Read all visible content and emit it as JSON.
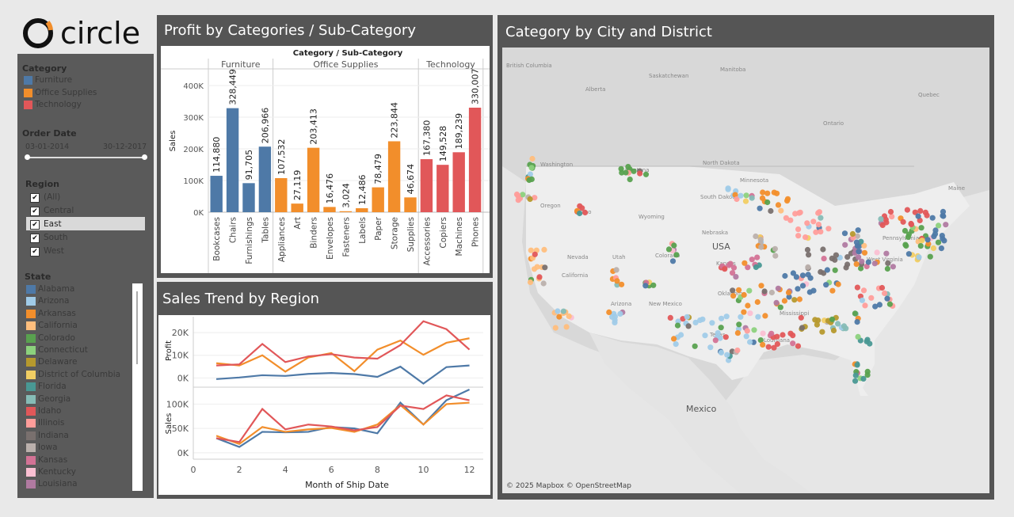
{
  "logo": {
    "text": "circle"
  },
  "sidebar": {
    "category": {
      "title": "Category",
      "items": [
        {
          "label": "Furniture",
          "color": "#4e79a7"
        },
        {
          "label": "Office Supplies",
          "color": "#f28e2b"
        },
        {
          "label": "Technology",
          "color": "#e15759"
        }
      ]
    },
    "order_date": {
      "title": "Order Date",
      "start": "03-01-2014",
      "end": "30-12-2017"
    },
    "region": {
      "title": "Region",
      "items": [
        {
          "label": "(All)",
          "checked": true
        },
        {
          "label": "Central",
          "checked": true
        },
        {
          "label": "East",
          "checked": true,
          "highlighted": true
        },
        {
          "label": "South",
          "checked": true
        },
        {
          "label": "West",
          "checked": true
        }
      ]
    },
    "state": {
      "title": "State",
      "items": [
        {
          "label": "Alabama",
          "color": "#4e79a7"
        },
        {
          "label": "Arizona",
          "color": "#a0cbe8"
        },
        {
          "label": "Arkansas",
          "color": "#f28e2b"
        },
        {
          "label": "California",
          "color": "#ffbe7d"
        },
        {
          "label": "Colorado",
          "color": "#59a14f"
        },
        {
          "label": "Connecticut",
          "color": "#8cd17d"
        },
        {
          "label": "Delaware",
          "color": "#b6992d"
        },
        {
          "label": "District of Columbia",
          "color": "#f1ce63"
        },
        {
          "label": "Florida",
          "color": "#499894"
        },
        {
          "label": "Georgia",
          "color": "#86bcb6"
        },
        {
          "label": "Idaho",
          "color": "#e15759"
        },
        {
          "label": "Illinois",
          "color": "#ff9d9a"
        },
        {
          "label": "Indiana",
          "color": "#79706e"
        },
        {
          "label": "Iowa",
          "color": "#bab0ac"
        },
        {
          "label": "Kansas",
          "color": "#d37295"
        },
        {
          "label": "Kentucky",
          "color": "#fabfd2"
        },
        {
          "label": "Louisiana",
          "color": "#b07aa1"
        }
      ]
    }
  },
  "profit_panel": {
    "title": "Profit by Categories / Sub-Category",
    "header_top": "Category  /  Sub-Category",
    "groups": [
      "Furniture",
      "Office Supplies",
      "Technology"
    ]
  },
  "trend_panel": {
    "title": "Sales Trend by Region",
    "xlabel": "Month of Ship Date"
  },
  "map_panel": {
    "title": "Category by City and District",
    "attribution": "© 2025 Mapbox © OpenStreetMap",
    "labels": [
      {
        "text": "British Columbia"
      },
      {
        "text": "Alberta"
      },
      {
        "text": "Saskatchewan"
      },
      {
        "text": "Manitoba"
      },
      {
        "text": "Ontario"
      },
      {
        "text": "Quebec"
      },
      {
        "text": "Washington"
      },
      {
        "text": "Montana"
      },
      {
        "text": "North Dakota"
      },
      {
        "text": "Minnesota"
      },
      {
        "text": "Oregon"
      },
      {
        "text": "Idaho"
      },
      {
        "text": "South Dakota"
      },
      {
        "text": "Wyoming"
      },
      {
        "text": "Nebraska"
      },
      {
        "text": "Nevada"
      },
      {
        "text": "Utah"
      },
      {
        "text": "Colorado"
      },
      {
        "text": "USA"
      },
      {
        "text": "Kansas"
      },
      {
        "text": "California"
      },
      {
        "text": "Arizona"
      },
      {
        "text": "New Mexico"
      },
      {
        "text": "Oklahoma"
      },
      {
        "text": "Texas"
      },
      {
        "text": "Mississippi"
      },
      {
        "text": "Louisiana"
      },
      {
        "text": "Mexico"
      },
      {
        "text": "Maine"
      },
      {
        "text": "Pennsylvania"
      },
      {
        "text": "West Virginia"
      }
    ]
  },
  "chart_data": [
    {
      "type": "bar",
      "title": "Profit by Categories / Sub-Category",
      "ylabel": "Sales",
      "ylim": [
        0,
        450000
      ],
      "yticks": [
        "0K",
        "100K",
        "200K",
        "300K",
        "400K"
      ],
      "categories": [
        "Bookcases",
        "Chairs",
        "Furnishings",
        "Tables",
        "Appliances",
        "Art",
        "Binders",
        "Envelopes",
        "Fasteners",
        "Labels",
        "Paper",
        "Storage",
        "Supplies",
        "Accessories",
        "Copiers",
        "Machines",
        "Phones"
      ],
      "groups": [
        "Furniture",
        "Furniture",
        "Furniture",
        "Furniture",
        "Office Supplies",
        "Office Supplies",
        "Office Supplies",
        "Office Supplies",
        "Office Supplies",
        "Office Supplies",
        "Office Supplies",
        "Office Supplies",
        "Office Supplies",
        "Technology",
        "Technology",
        "Technology",
        "Technology"
      ],
      "values": [
        114880,
        328449,
        91705,
        206966,
        107532,
        27119,
        203413,
        16476,
        3024,
        12486,
        78479,
        223844,
        46674,
        167380,
        149528,
        189239,
        330007
      ],
      "value_labels": [
        "114,880",
        "328,449",
        "91,705",
        "206,966",
        "107,532",
        "27,119",
        "203,413",
        "16,476",
        "3,024",
        "12,486",
        "78,479",
        "223,844",
        "46,674",
        "167,380",
        "149,528",
        "189,239",
        "330,007"
      ],
      "colors": {
        "Furniture": "#4e79a7",
        "Office Supplies": "#f28e2b",
        "Technology": "#e15759"
      }
    },
    {
      "type": "line",
      "title": "Sales Trend by Region",
      "xlabel": "Month of Ship Date",
      "x": [
        1,
        2,
        3,
        4,
        5,
        6,
        7,
        8,
        9,
        10,
        11,
        12
      ],
      "xticks": [
        0,
        2,
        4,
        6,
        8,
        10,
        12
      ],
      "panes": [
        {
          "ylabel": "Profit",
          "ylim": [
            -3000,
            27000
          ],
          "yticks": [
            0,
            10000,
            20000
          ],
          "ytick_labels": [
            "0K",
            "10K",
            "20K"
          ],
          "series": [
            {
              "color": "#4e79a7",
              "values": [
                -500,
                200,
                1200,
                900,
                1800,
                2200,
                1700,
                500,
                5000,
                -2500,
                4800,
                5500
              ]
            },
            {
              "color": "#f28e2b",
              "values": [
                6500,
                5500,
                10000,
                2800,
                9000,
                11000,
                3000,
                12500,
                16500,
                10200,
                15500,
                17500
              ]
            },
            {
              "color": "#e15759",
              "values": [
                5500,
                6000,
                15000,
                7000,
                9500,
                10500,
                9000,
                8500,
                14500,
                25000,
                21500,
                12500
              ]
            }
          ]
        },
        {
          "ylabel": "Sales",
          "ylim": [
            -10000,
            130000
          ],
          "yticks": [
            0,
            50000,
            100000
          ],
          "ytick_labels": [
            "0K",
            "50K",
            "100K"
          ],
          "series": [
            {
              "color": "#4e79a7",
              "values": [
                30000,
                12000,
                43000,
                42000,
                43000,
                53000,
                50000,
                40000,
                103000,
                58000,
                108000,
                130000
              ]
            },
            {
              "color": "#f28e2b",
              "values": [
                35000,
                18000,
                53000,
                43000,
                48000,
                51000,
                43000,
                58000,
                98000,
                58000,
                100000,
                103000
              ]
            },
            {
              "color": "#e15759",
              "values": [
                30000,
                22000,
                90000,
                48000,
                58000,
                54000,
                46000,
                53000,
                97000,
                90000,
                118000,
                108000
              ]
            }
          ]
        }
      ]
    }
  ]
}
